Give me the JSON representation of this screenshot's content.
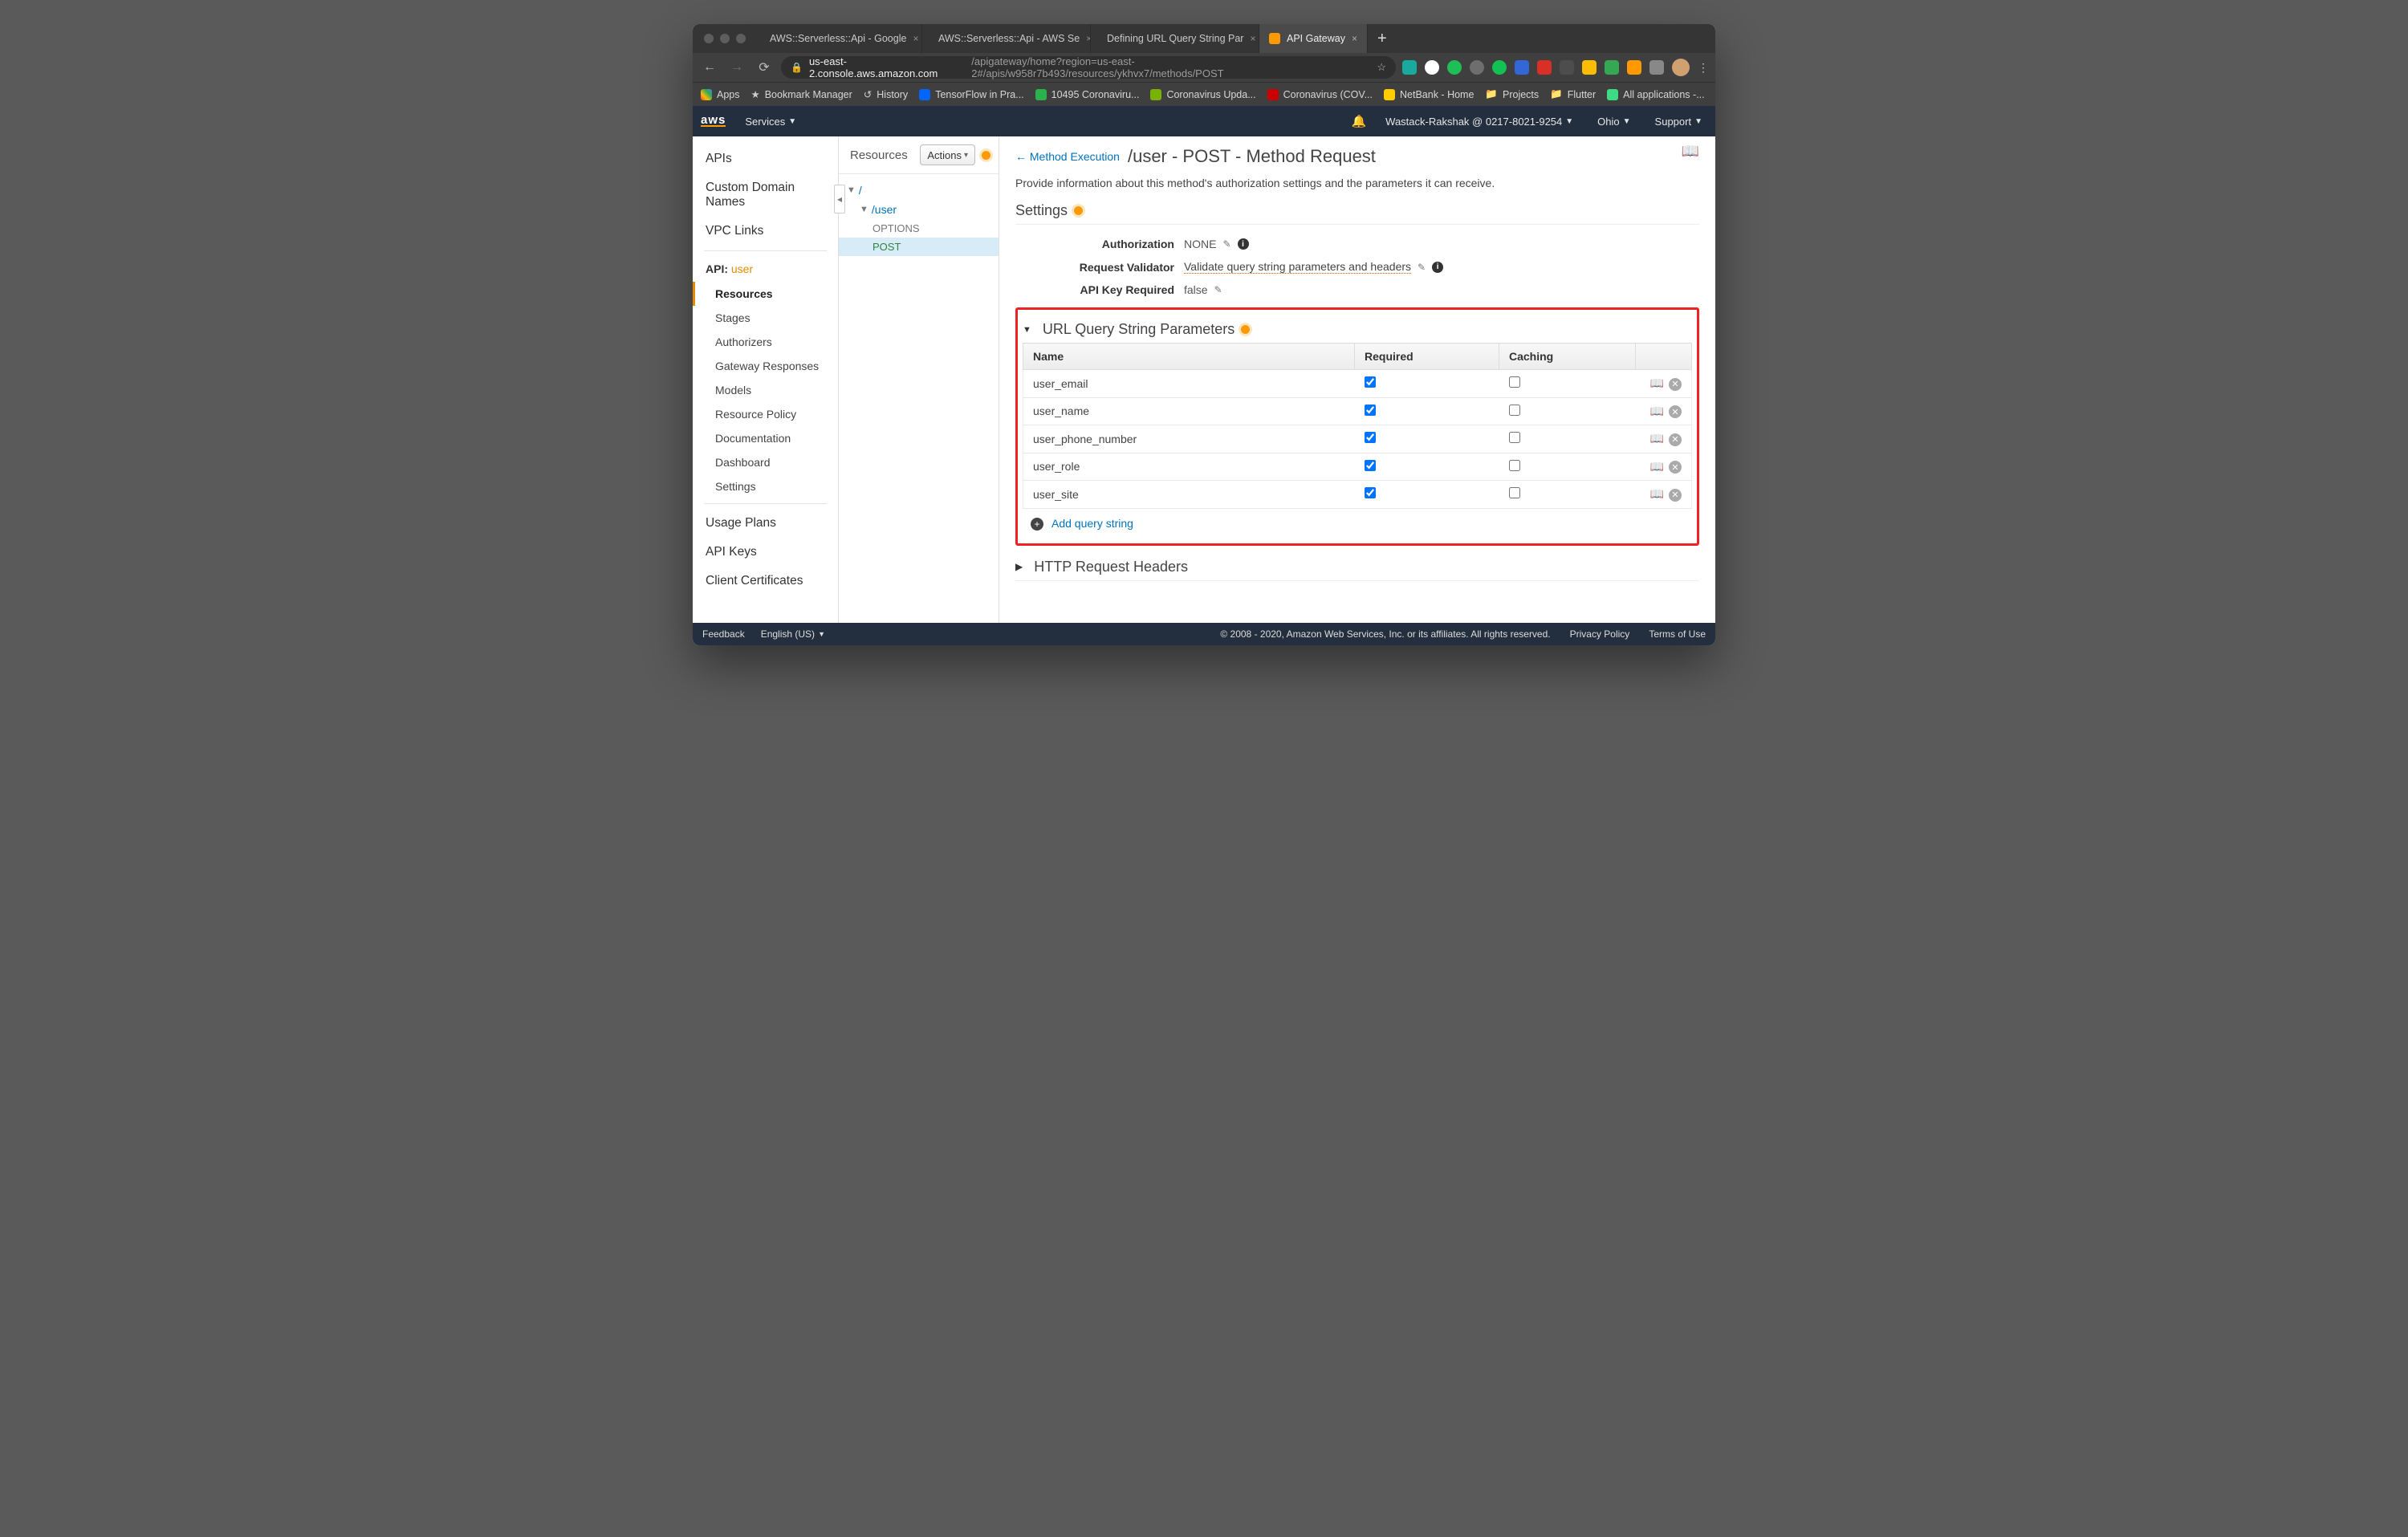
{
  "browser": {
    "tabs": [
      {
        "title": "AWS::Serverless::Api - Google"
      },
      {
        "title": "AWS::Serverless::Api - AWS Se"
      },
      {
        "title": "Defining URL Query String Par"
      },
      {
        "title": "API Gateway",
        "active": true
      }
    ],
    "url_host": "us-east-2.console.aws.amazon.com",
    "url_path": "/apigateway/home?region=us-east-2#/apis/w958r7b493/resources/ykhvx7/methods/POST"
  },
  "bookmarks": [
    {
      "label": "Apps"
    },
    {
      "label": "Bookmark Manager"
    },
    {
      "label": "History"
    },
    {
      "label": "TensorFlow in Pra..."
    },
    {
      "label": "10495 Coronaviru..."
    },
    {
      "label": "Coronavirus Upda..."
    },
    {
      "label": "Coronavirus (COV..."
    },
    {
      "label": "NetBank - Home"
    },
    {
      "label": "Projects"
    },
    {
      "label": "Flutter"
    },
    {
      "label": "All applications -..."
    }
  ],
  "aws_header": {
    "services": "Services",
    "account": "Wastack-Rakshak @ 0217-8021-9254",
    "region": "Ohio",
    "support": "Support"
  },
  "left_nav": {
    "top": [
      "APIs",
      "Custom Domain Names",
      "VPC Links"
    ],
    "api_prefix": "API:",
    "api_name": "user",
    "items": [
      "Resources",
      "Stages",
      "Authorizers",
      "Gateway Responses",
      "Models",
      "Resource Policy",
      "Documentation",
      "Dashboard",
      "Settings"
    ],
    "active": "Resources",
    "bottom": [
      "Usage Plans",
      "API Keys",
      "Client Certificates"
    ]
  },
  "resources": {
    "heading": "Resources",
    "actions": "Actions",
    "root": "/",
    "user": "/user",
    "options": "OPTIONS",
    "post": "POST"
  },
  "main": {
    "back": "Method Execution",
    "title": "/user - POST - Method Request",
    "description": "Provide information about this method's authorization settings and the parameters it can receive.",
    "settings": {
      "heading": "Settings",
      "authorization_k": "Authorization",
      "authorization_v": "NONE",
      "validator_k": "Request Validator",
      "validator_v": "Validate query string parameters and headers",
      "apikey_k": "API Key Required",
      "apikey_v": "false"
    },
    "qsp": {
      "heading": "URL Query String Parameters",
      "cols": {
        "name": "Name",
        "required": "Required",
        "caching": "Caching"
      },
      "rows": [
        {
          "name": "user_email",
          "required": true,
          "caching": false
        },
        {
          "name": "user_name",
          "required": true,
          "caching": false
        },
        {
          "name": "user_phone_number",
          "required": true,
          "caching": false
        },
        {
          "name": "user_role",
          "required": true,
          "caching": false
        },
        {
          "name": "user_site",
          "required": true,
          "caching": false
        }
      ],
      "add": "Add query string"
    },
    "headers": {
      "heading": "HTTP Request Headers"
    }
  },
  "footer": {
    "feedback": "Feedback",
    "lang": "English (US)",
    "copyright": "© 2008 - 2020, Amazon Web Services, Inc. or its affiliates. All rights reserved.",
    "privacy": "Privacy Policy",
    "terms": "Terms of Use"
  }
}
